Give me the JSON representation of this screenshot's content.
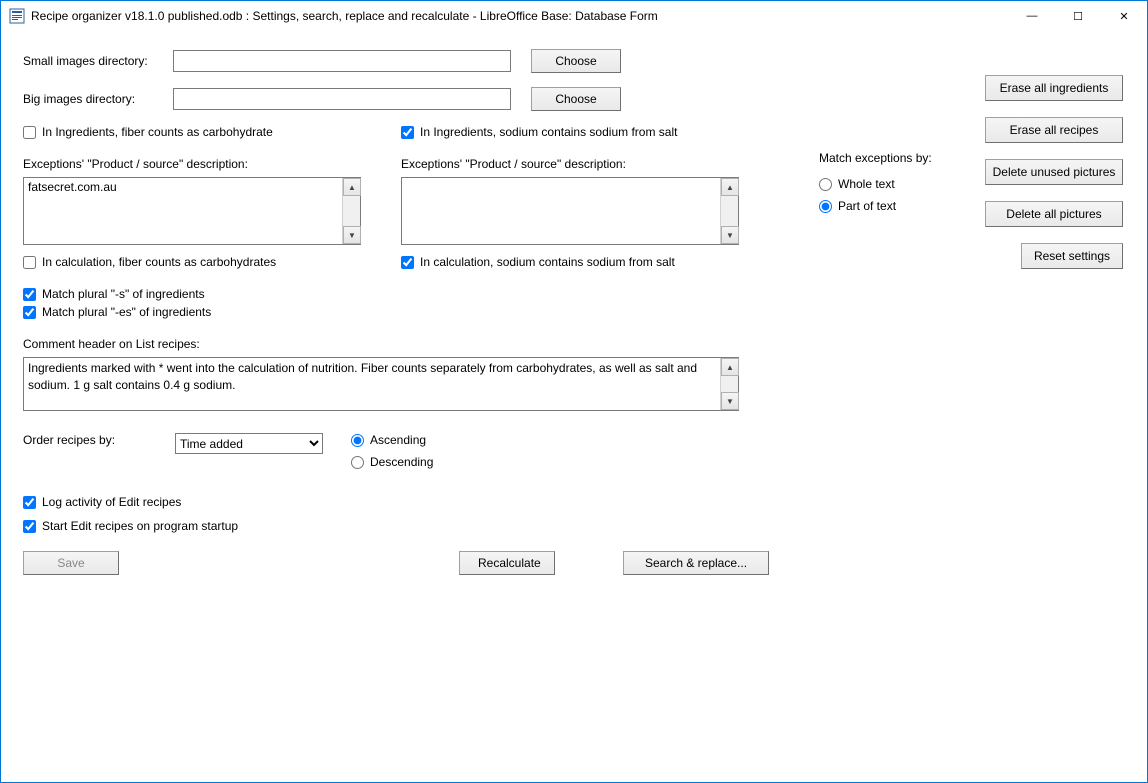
{
  "window": {
    "title": "Recipe organizer v18.1.0 published.odb : Settings, search, replace and recalculate - LibreOffice Base: Database Form"
  },
  "labels": {
    "small_dir": "Small images directory:",
    "big_dir": "Big images directory:",
    "choose": "Choose",
    "fiber_carb": "In Ingredients, fiber counts as carbohydrate",
    "sodium_salt": "In Ingredients, sodium contains sodium from salt",
    "exc_desc": "Exceptions' \"Product / source\" description:",
    "calc_fiber": "In calculation, fiber counts as carbohydrates",
    "calc_sodium": "In calculation, sodium contains sodium from salt",
    "match_s": "Match plural \"-s\" of ingredients",
    "match_es": "Match plural \"-es\" of ingredients",
    "comment_hdr": "Comment header on List recipes:",
    "order_by": "Order recipes by:",
    "asc": "Ascending",
    "desc": "Descending",
    "log_act": "Log activity of Edit recipes",
    "start_edit": "Start Edit recipes on program startup",
    "save": "Save",
    "recalc": "Recalculate",
    "search_replace": "Search & replace...",
    "match_ex": "Match exceptions by:",
    "whole_text": "Whole text",
    "part_text": "Part of text"
  },
  "values": {
    "small_dir": "",
    "big_dir": "",
    "exc1": "fatsecret.com.au",
    "exc2": "",
    "comment": "Ingredients marked with * went into the calculation of nutrition. Fiber counts separately from carbohydrates, as well as salt and sodium. 1 g salt contains 0.4 g sodium.",
    "order_sel": "Time added"
  },
  "sidebtns": {
    "erase_ing": "Erase all ingredients",
    "erase_rec": "Erase all recipes",
    "del_unused": "Delete unused pictures",
    "del_all": "Delete all pictures",
    "reset": "Reset settings"
  }
}
